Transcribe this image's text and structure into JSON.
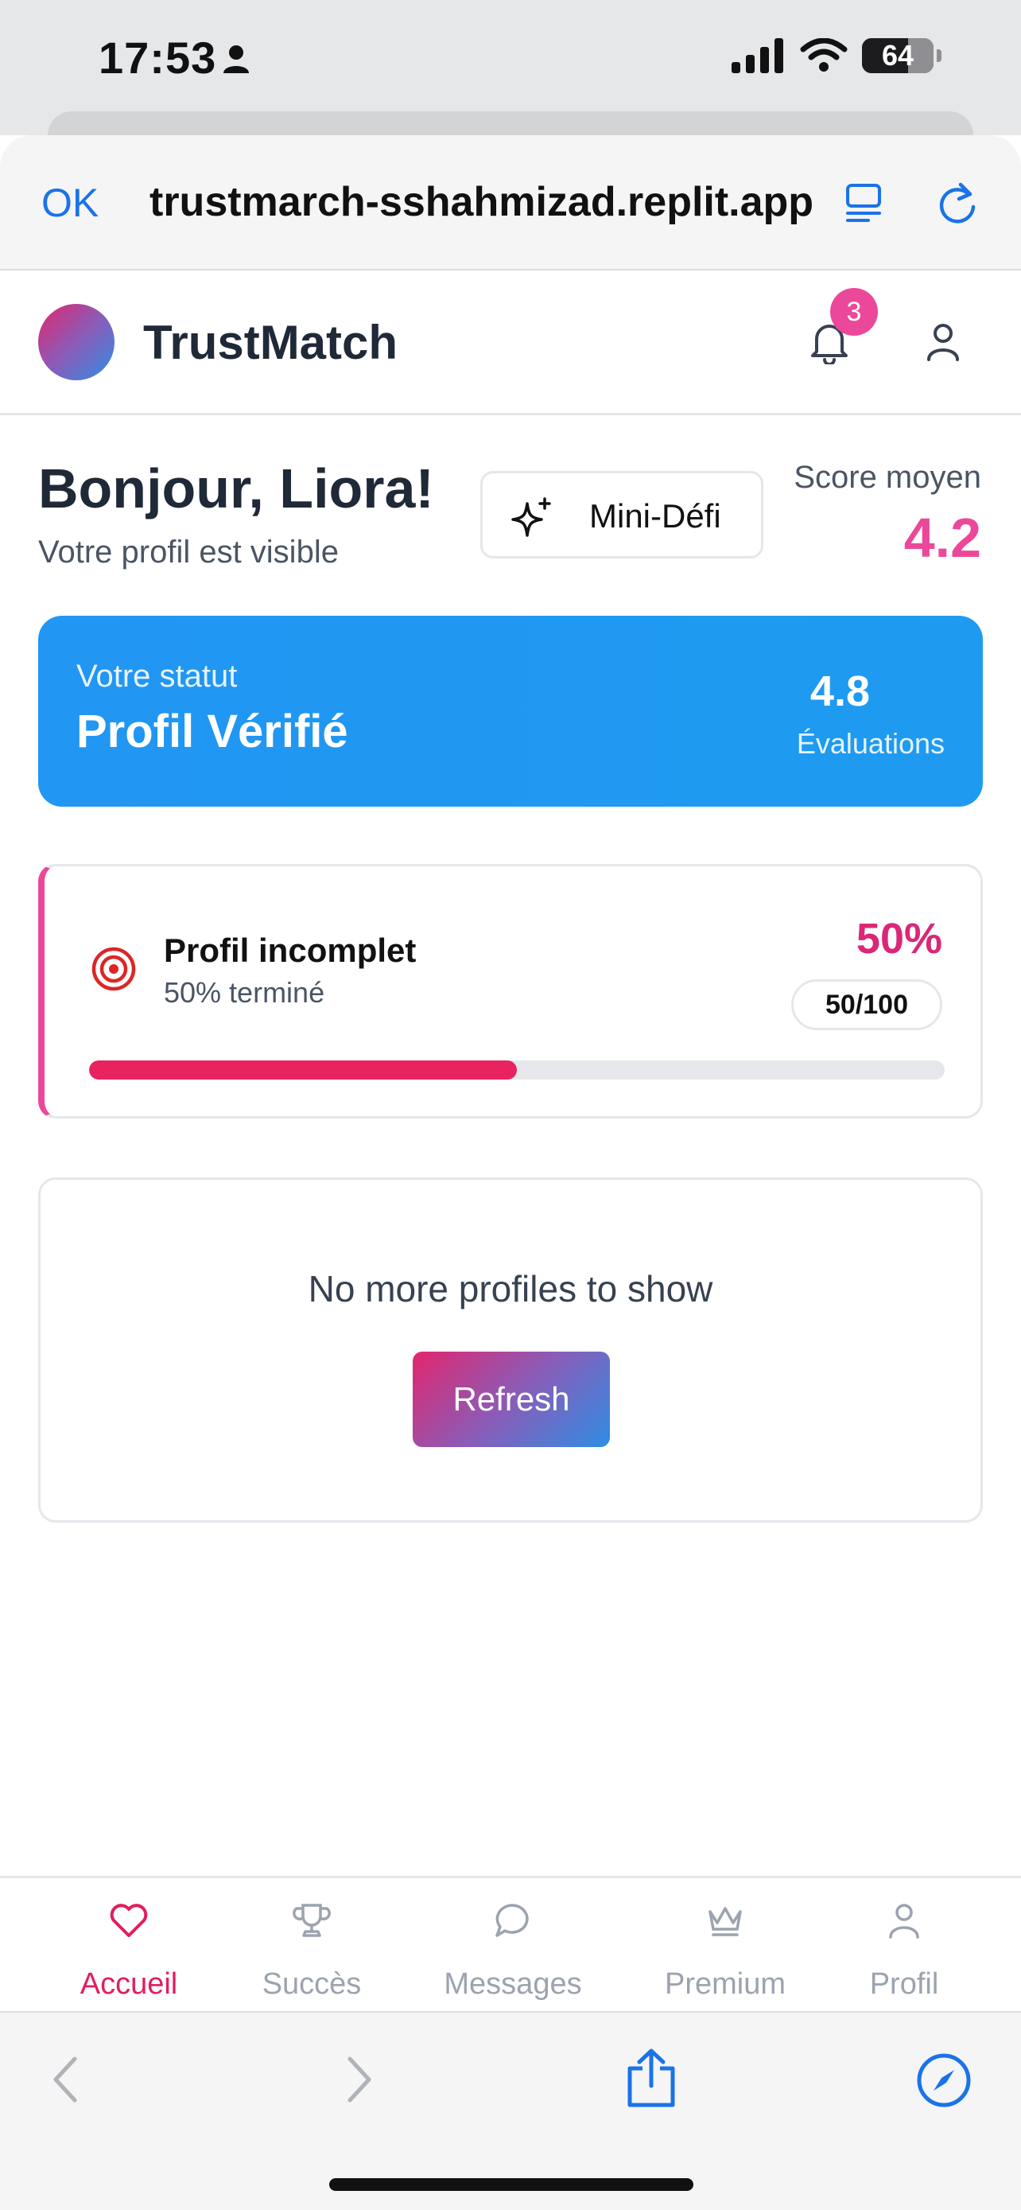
{
  "status_bar": {
    "time": "17:53",
    "battery": "64"
  },
  "browser": {
    "ok_label": "OK",
    "url": "trustmarch-sshahmizad.replit.app"
  },
  "app": {
    "brand": "TrustMatch",
    "notification_count": "3"
  },
  "greeting": {
    "title": "Bonjour, Liora!",
    "subtitle": "Votre profil est visible",
    "mini_defi_label": "Mini-Défi",
    "score_label": "Score moyen",
    "score_value": "4.2"
  },
  "status_card": {
    "label": "Votre statut",
    "title": "Profil Vérifié",
    "rating": "4.8",
    "rating_label": "Évaluations"
  },
  "profile_progress": {
    "title": "Profil incomplet",
    "subtitle": "50% terminé",
    "percent_text": "50%",
    "points_text": "50/100",
    "progress_fraction": 0.5
  },
  "empty_state": {
    "message": "No more profiles to show",
    "button_label": "Refresh"
  },
  "bottom_nav": {
    "items": [
      {
        "label": "Accueil",
        "icon": "heart-icon",
        "active": true
      },
      {
        "label": "Succès",
        "icon": "trophy-icon",
        "active": false
      },
      {
        "label": "Messages",
        "icon": "chat-bubble-icon",
        "active": false
      },
      {
        "label": "Premium",
        "icon": "crown-icon",
        "active": false
      },
      {
        "label": "Profil",
        "icon": "user-icon",
        "active": false
      }
    ]
  },
  "colors": {
    "accent_pink": "#ec4899",
    "status_blue": "#2196f3",
    "link_blue": "#1a73e8"
  }
}
